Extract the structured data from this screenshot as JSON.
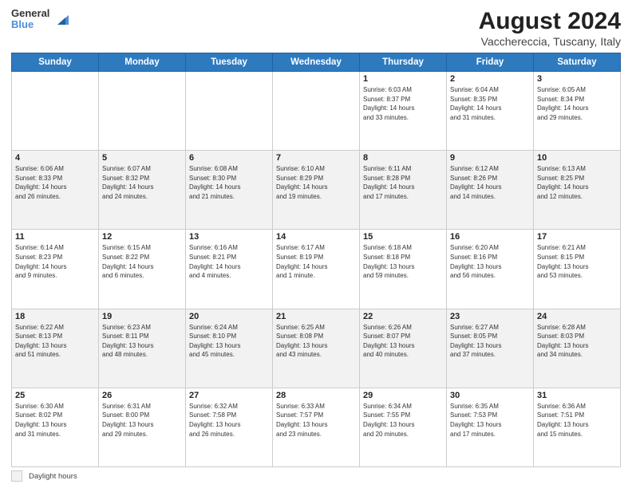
{
  "logo": {
    "line1": "General",
    "line2": "Blue"
  },
  "title": "August 2024",
  "subtitle": "Vacchereccia, Tuscany, Italy",
  "days_of_week": [
    "Sunday",
    "Monday",
    "Tuesday",
    "Wednesday",
    "Thursday",
    "Friday",
    "Saturday"
  ],
  "weeks": [
    [
      {
        "day": "",
        "info": ""
      },
      {
        "day": "",
        "info": ""
      },
      {
        "day": "",
        "info": ""
      },
      {
        "day": "",
        "info": ""
      },
      {
        "day": "1",
        "info": "Sunrise: 6:03 AM\nSunset: 8:37 PM\nDaylight: 14 hours\nand 33 minutes."
      },
      {
        "day": "2",
        "info": "Sunrise: 6:04 AM\nSunset: 8:35 PM\nDaylight: 14 hours\nand 31 minutes."
      },
      {
        "day": "3",
        "info": "Sunrise: 6:05 AM\nSunset: 8:34 PM\nDaylight: 14 hours\nand 29 minutes."
      }
    ],
    [
      {
        "day": "4",
        "info": "Sunrise: 6:06 AM\nSunset: 8:33 PM\nDaylight: 14 hours\nand 26 minutes."
      },
      {
        "day": "5",
        "info": "Sunrise: 6:07 AM\nSunset: 8:32 PM\nDaylight: 14 hours\nand 24 minutes."
      },
      {
        "day": "6",
        "info": "Sunrise: 6:08 AM\nSunset: 8:30 PM\nDaylight: 14 hours\nand 21 minutes."
      },
      {
        "day": "7",
        "info": "Sunrise: 6:10 AM\nSunset: 8:29 PM\nDaylight: 14 hours\nand 19 minutes."
      },
      {
        "day": "8",
        "info": "Sunrise: 6:11 AM\nSunset: 8:28 PM\nDaylight: 14 hours\nand 17 minutes."
      },
      {
        "day": "9",
        "info": "Sunrise: 6:12 AM\nSunset: 8:26 PM\nDaylight: 14 hours\nand 14 minutes."
      },
      {
        "day": "10",
        "info": "Sunrise: 6:13 AM\nSunset: 8:25 PM\nDaylight: 14 hours\nand 12 minutes."
      }
    ],
    [
      {
        "day": "11",
        "info": "Sunrise: 6:14 AM\nSunset: 8:23 PM\nDaylight: 14 hours\nand 9 minutes."
      },
      {
        "day": "12",
        "info": "Sunrise: 6:15 AM\nSunset: 8:22 PM\nDaylight: 14 hours\nand 6 minutes."
      },
      {
        "day": "13",
        "info": "Sunrise: 6:16 AM\nSunset: 8:21 PM\nDaylight: 14 hours\nand 4 minutes."
      },
      {
        "day": "14",
        "info": "Sunrise: 6:17 AM\nSunset: 8:19 PM\nDaylight: 14 hours\nand 1 minute."
      },
      {
        "day": "15",
        "info": "Sunrise: 6:18 AM\nSunset: 8:18 PM\nDaylight: 13 hours\nand 59 minutes."
      },
      {
        "day": "16",
        "info": "Sunrise: 6:20 AM\nSunset: 8:16 PM\nDaylight: 13 hours\nand 56 minutes."
      },
      {
        "day": "17",
        "info": "Sunrise: 6:21 AM\nSunset: 8:15 PM\nDaylight: 13 hours\nand 53 minutes."
      }
    ],
    [
      {
        "day": "18",
        "info": "Sunrise: 6:22 AM\nSunset: 8:13 PM\nDaylight: 13 hours\nand 51 minutes."
      },
      {
        "day": "19",
        "info": "Sunrise: 6:23 AM\nSunset: 8:11 PM\nDaylight: 13 hours\nand 48 minutes."
      },
      {
        "day": "20",
        "info": "Sunrise: 6:24 AM\nSunset: 8:10 PM\nDaylight: 13 hours\nand 45 minutes."
      },
      {
        "day": "21",
        "info": "Sunrise: 6:25 AM\nSunset: 8:08 PM\nDaylight: 13 hours\nand 43 minutes."
      },
      {
        "day": "22",
        "info": "Sunrise: 6:26 AM\nSunset: 8:07 PM\nDaylight: 13 hours\nand 40 minutes."
      },
      {
        "day": "23",
        "info": "Sunrise: 6:27 AM\nSunset: 8:05 PM\nDaylight: 13 hours\nand 37 minutes."
      },
      {
        "day": "24",
        "info": "Sunrise: 6:28 AM\nSunset: 8:03 PM\nDaylight: 13 hours\nand 34 minutes."
      }
    ],
    [
      {
        "day": "25",
        "info": "Sunrise: 6:30 AM\nSunset: 8:02 PM\nDaylight: 13 hours\nand 31 minutes."
      },
      {
        "day": "26",
        "info": "Sunrise: 6:31 AM\nSunset: 8:00 PM\nDaylight: 13 hours\nand 29 minutes."
      },
      {
        "day": "27",
        "info": "Sunrise: 6:32 AM\nSunset: 7:58 PM\nDaylight: 13 hours\nand 26 minutes."
      },
      {
        "day": "28",
        "info": "Sunrise: 6:33 AM\nSunset: 7:57 PM\nDaylight: 13 hours\nand 23 minutes."
      },
      {
        "day": "29",
        "info": "Sunrise: 6:34 AM\nSunset: 7:55 PM\nDaylight: 13 hours\nand 20 minutes."
      },
      {
        "day": "30",
        "info": "Sunrise: 6:35 AM\nSunset: 7:53 PM\nDaylight: 13 hours\nand 17 minutes."
      },
      {
        "day": "31",
        "info": "Sunrise: 6:36 AM\nSunset: 7:51 PM\nDaylight: 13 hours\nand 15 minutes."
      }
    ]
  ],
  "legend": {
    "box_label": "Daylight hours"
  }
}
